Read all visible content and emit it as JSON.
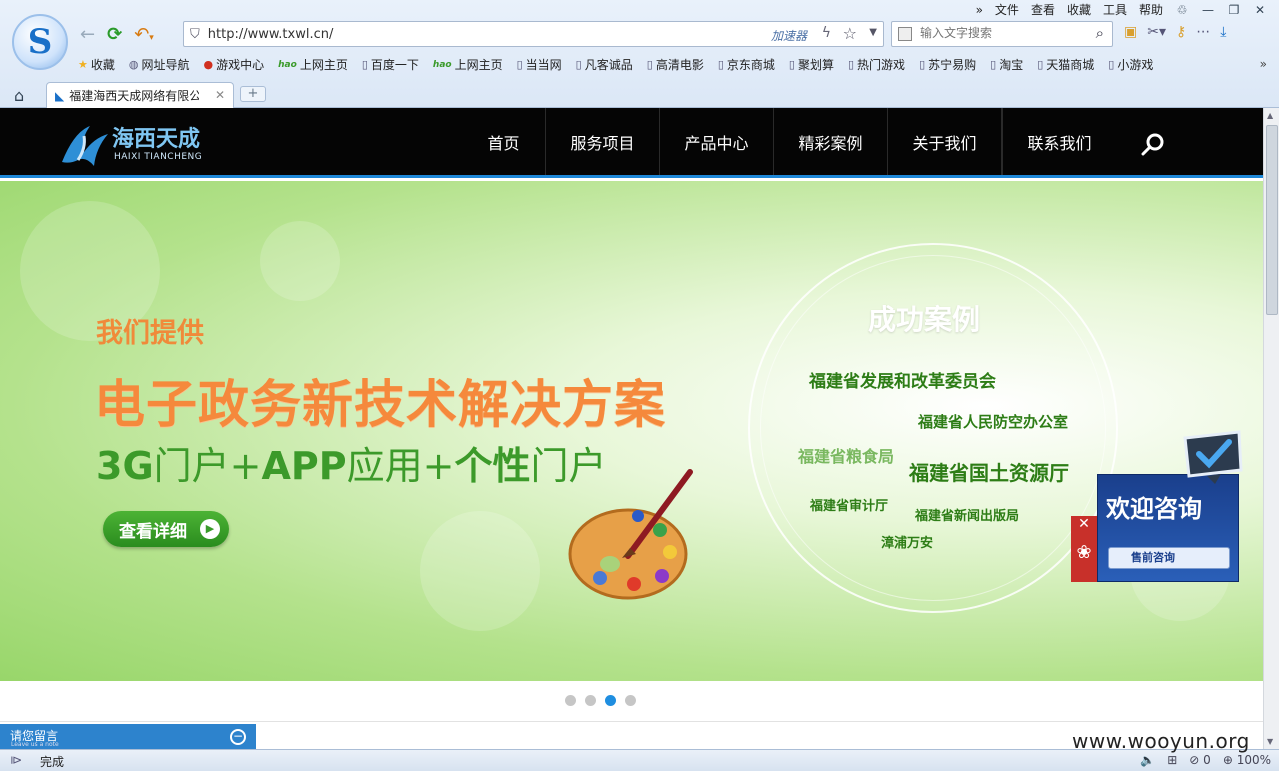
{
  "browser": {
    "menu": [
      "文件",
      "查看",
      "收藏",
      "工具",
      "帮助"
    ],
    "menu_more": "»",
    "url": "http://www.txwl.cn/",
    "accelerator": "加速器",
    "search_placeholder": "输入文字搜索",
    "bookmarks": [
      {
        "label": "收藏",
        "icon": "star-icon"
      },
      {
        "label": "网址导航",
        "icon": "globe-icon"
      },
      {
        "label": "游戏中心",
        "icon": "game-icon"
      },
      {
        "label": "上网主页",
        "icon": "hao-icon"
      },
      {
        "label": "百度一下",
        "icon": "page-icon"
      },
      {
        "label": "上网主页",
        "icon": "hao-icon"
      },
      {
        "label": "当当网",
        "icon": "page-icon"
      },
      {
        "label": "凡客诚品",
        "icon": "page-icon"
      },
      {
        "label": "高清电影",
        "icon": "page-icon"
      },
      {
        "label": "京东商城",
        "icon": "page-icon"
      },
      {
        "label": "聚划算",
        "icon": "page-icon"
      },
      {
        "label": "热门游戏",
        "icon": "page-icon"
      },
      {
        "label": "苏宁易购",
        "icon": "page-icon"
      },
      {
        "label": "淘宝",
        "icon": "page-icon"
      },
      {
        "label": "天猫商城",
        "icon": "page-icon"
      },
      {
        "label": "小游戏",
        "icon": "page-icon"
      }
    ],
    "bookmarks_more": "»",
    "tab_title": "福建海西天成网络有限公",
    "new_tab": "+",
    "status": "完成",
    "status_right": {
      "zero": "0",
      "zoom": "100%"
    }
  },
  "site": {
    "logo_cn": "海西天成",
    "logo_en": "HAIXI TIANCHENG",
    "nav": [
      "首页",
      "服务项目",
      "产品中心",
      "精彩案例",
      "关于我们",
      "联系我们"
    ],
    "banner": {
      "provide": "我们提供",
      "title": "电子政务新技术解决方案",
      "sub_parts": [
        "3G",
        "门户+",
        "APP",
        "应用+",
        "个性",
        "门户"
      ],
      "detail_button": "查看详细",
      "cases_title": "成功案例",
      "cases": [
        "福建省发展和改革委员会",
        "福建省人民防空办公室",
        "福建省粮食局",
        "福建省国土资源厅",
        "福建省审计厅",
        "福建省新闻出版局",
        "漳浦万安"
      ]
    },
    "consult": {
      "title": "欢迎咨询",
      "button": "售前咨询"
    },
    "slider_dots": 4,
    "slider_active": 3,
    "message_bar": {
      "title": "请您留言",
      "subtitle": "Leave us a note"
    }
  },
  "watermark": "www.wooyun.org"
}
